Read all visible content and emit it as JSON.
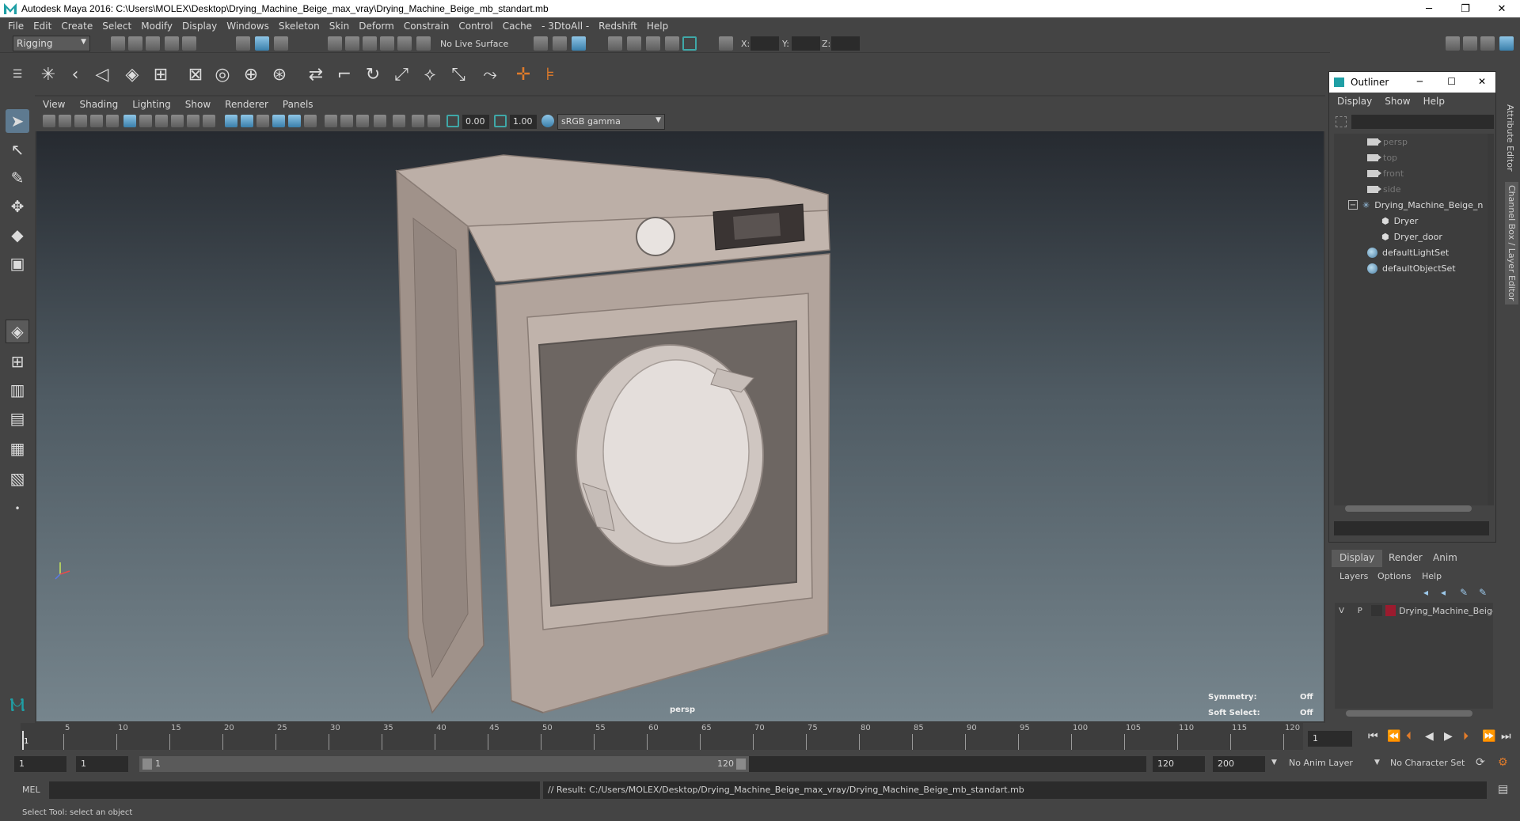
{
  "window": {
    "title": "Autodesk Maya 2016: C:\\Users\\MOLEX\\Desktop\\Drying_Machine_Beige_max_vray\\Drying_Machine_Beige_mb_standart.mb",
    "minimize": "─",
    "restore": "❐",
    "close": "✕"
  },
  "menubar": [
    "File",
    "Edit",
    "Create",
    "Select",
    "Modify",
    "Display",
    "Windows",
    "Skeleton",
    "Skin",
    "Deform",
    "Constrain",
    "Control",
    "Cache",
    "- 3DtoAll -",
    "Redshift",
    "Help"
  ],
  "statusline": {
    "mode": "Rigging",
    "live_surface": "No Live Surface",
    "x_label": "X:",
    "y_label": "Y:",
    "z_label": "Z:"
  },
  "panel": {
    "menus": [
      "View",
      "Shading",
      "Lighting",
      "Show",
      "Renderer",
      "Panels"
    ],
    "near_value": "0.00",
    "far_value": "1.00",
    "colorspace": "sRGB gamma"
  },
  "viewport": {
    "camera_label": "persp",
    "symmetry_label": "Symmetry:",
    "symmetry_value": "Off",
    "soft_select_label": "Soft Select:",
    "soft_select_value": "Off",
    "colors": {
      "body": "#b2a49c",
      "glass": "#6d6662",
      "background_top": "#262a30",
      "background_bottom": "#76858d"
    }
  },
  "outliner": {
    "title": "Outliner",
    "menus": [
      "Display",
      "Show",
      "Help"
    ],
    "items": [
      {
        "label": "persp",
        "icon": "camera-icon",
        "dim": true
      },
      {
        "label": "top",
        "icon": "camera-icon",
        "dim": true
      },
      {
        "label": "front",
        "icon": "camera-icon",
        "dim": true
      },
      {
        "label": "side",
        "icon": "camera-icon",
        "dim": true
      },
      {
        "label": "Drying_Machine_Beige_n",
        "icon": "group-icon",
        "dim": false
      },
      {
        "label": "Dryer",
        "icon": "mesh-icon",
        "dim": false
      },
      {
        "label": "Dryer_door",
        "icon": "mesh-icon",
        "dim": false
      },
      {
        "label": "defaultLightSet",
        "icon": "set-icon",
        "dim": false
      },
      {
        "label": "defaultObjectSet",
        "icon": "set-icon",
        "dim": false
      }
    ]
  },
  "layer_editor": {
    "tabs": [
      "Display",
      "Render",
      "Anim"
    ],
    "menus": [
      "Layers",
      "Options",
      "Help"
    ],
    "layer": {
      "v": "V",
      "p": "P",
      "name": "Drying_Machine_Beige",
      "color": "#9b1b2e"
    }
  },
  "sidetabs": {
    "attribute_editor": "Attribute Editor",
    "channel_box": "Channel Box / Layer Editor"
  },
  "timeline": {
    "ticks": [
      5,
      10,
      15,
      20,
      25,
      30,
      35,
      40,
      45,
      50,
      55,
      60,
      65,
      70,
      75,
      80,
      85,
      90,
      95,
      100,
      105,
      110,
      115,
      120
    ],
    "current_frame_marker": "1",
    "current_frame": "1"
  },
  "range": {
    "start": "1",
    "playback_start": "1",
    "slider_start": "1",
    "slider_end": "120",
    "playback_end": "120",
    "end": "200",
    "anim_layer": "No Anim Layer",
    "character_set": "No Character Set"
  },
  "commandline": {
    "language": "MEL",
    "result": "// Result: C:/Users/MOLEX/Desktop/Drying_Machine_Beige_max_vray/Drying_Machine_Beige_mb_standart.mb"
  },
  "helpline": "Select Tool: select an object"
}
